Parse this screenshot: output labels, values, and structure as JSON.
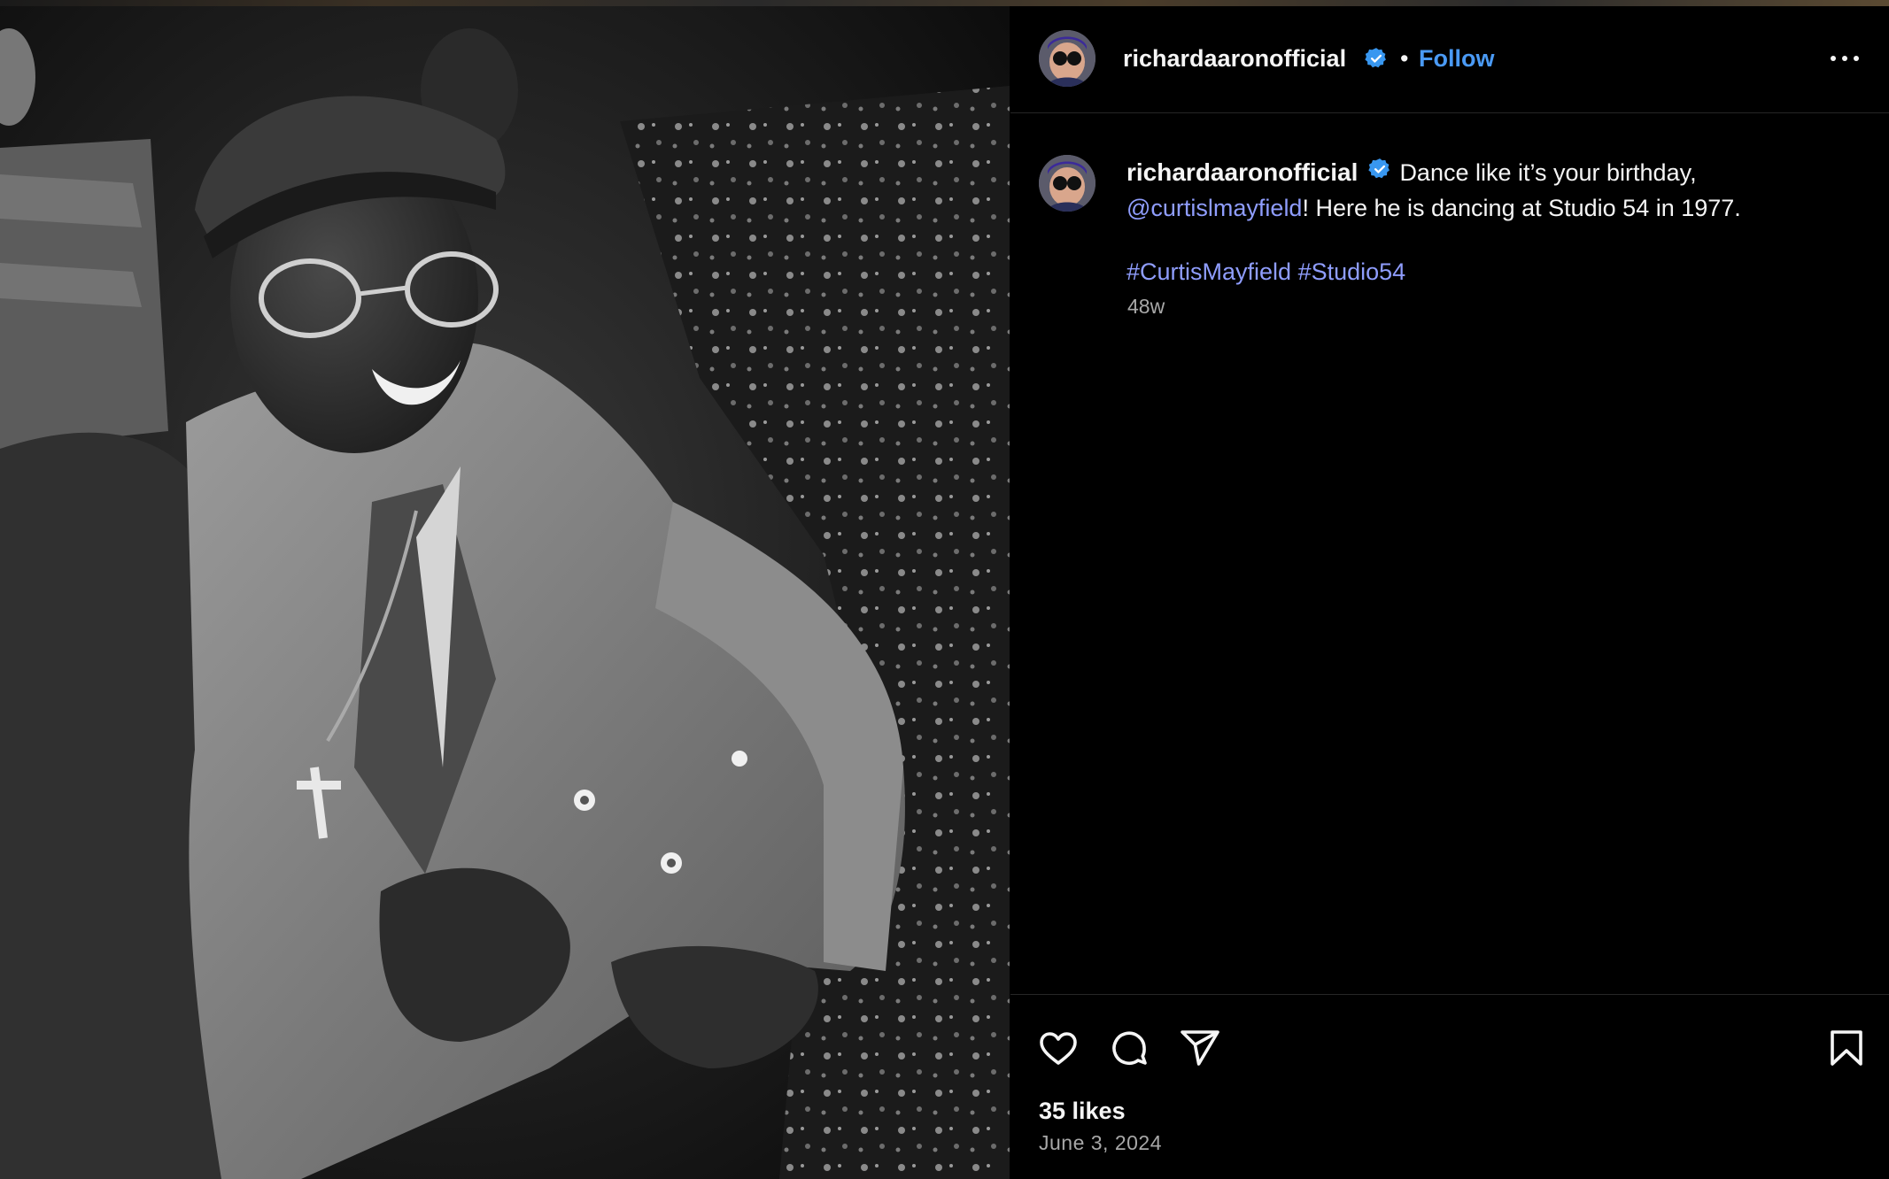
{
  "post": {
    "username": "richardaaronofficial",
    "verified": true,
    "separator": "•",
    "follow_label": "Follow",
    "more_label": "More options"
  },
  "caption": {
    "username": "richardaaronofficial",
    "text_1": "Dance like it’s your birthday,",
    "mention": "@curtislmayfield",
    "text_2": "! Here he is dancing at Studio 54 in 1977.",
    "hashtags": [
      "#CurtisMayfield",
      "#Studio54"
    ],
    "time": "48w"
  },
  "actions": {
    "icons": [
      "heart-icon",
      "comment-icon",
      "share-icon",
      "bookmark-icon"
    ],
    "likes": "35 likes",
    "date": "June 3, 2024"
  },
  "colors": {
    "background": "#000000",
    "text": "#f5f5f5",
    "follow": "#4a9af5",
    "link": "#8f9dfd",
    "muted": "#a8a8a8",
    "verified": "#3897f0"
  }
}
